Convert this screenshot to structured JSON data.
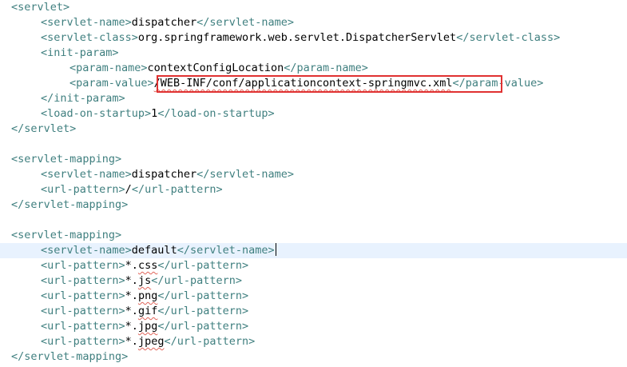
{
  "editor": {
    "lines": [
      {
        "parts": [
          {
            "t": "<servlet>",
            "c": "tag"
          }
        ]
      },
      {
        "parts": [
          {
            "t": "<servlet-name>",
            "c": "tag"
          },
          {
            "t": "dispatcher",
            "c": "text"
          },
          {
            "t": "</servlet-name>",
            "c": "tag"
          }
        ]
      },
      {
        "parts": [
          {
            "t": "<servlet-class>",
            "c": "tag"
          },
          {
            "t": "org.springframework.web.servlet.DispatcherServlet",
            "c": "text"
          },
          {
            "t": "</servlet-class>",
            "c": "tag"
          }
        ]
      },
      {
        "parts": [
          {
            "t": "<init-param>",
            "c": "tag"
          }
        ]
      },
      {
        "parts": [
          {
            "t": "<param-name>",
            "c": "tag"
          },
          {
            "t": "contextConfigLocation",
            "c": "text"
          },
          {
            "t": "</param-name>",
            "c": "tag"
          }
        ]
      },
      {
        "parts": [
          {
            "t": "<param-value>",
            "c": "tag"
          },
          {
            "t": "/WEB-INF/conf/applicationcontext-springmvc.xml",
            "c": "text squiggle"
          },
          {
            "t": "</param-value>",
            "c": "tag"
          }
        ]
      },
      {
        "parts": [
          {
            "t": "</init-param>",
            "c": "tag"
          }
        ]
      },
      {
        "parts": [
          {
            "t": "<load-on-startup>",
            "c": "tag"
          },
          {
            "t": "1",
            "c": "text"
          },
          {
            "t": "</load-on-startup>",
            "c": "tag"
          }
        ]
      },
      {
        "parts": [
          {
            "t": "</servlet>",
            "c": "tag"
          }
        ]
      },
      {
        "parts": []
      },
      {
        "parts": [
          {
            "t": "<servlet-mapping>",
            "c": "tag"
          }
        ]
      },
      {
        "parts": [
          {
            "t": "<servlet-name>",
            "c": "tag"
          },
          {
            "t": "dispatcher",
            "c": "text"
          },
          {
            "t": "</servlet-name>",
            "c": "tag"
          }
        ]
      },
      {
        "parts": [
          {
            "t": "<url-pattern>",
            "c": "tag"
          },
          {
            "t": "/",
            "c": "text"
          },
          {
            "t": "</url-pattern>",
            "c": "tag"
          }
        ]
      },
      {
        "parts": [
          {
            "t": "</servlet-mapping>",
            "c": "tag"
          }
        ]
      },
      {
        "parts": []
      },
      {
        "parts": [
          {
            "t": "<servlet-mapping>",
            "c": "tag"
          }
        ]
      },
      {
        "parts": [
          {
            "t": "<servlet-name>",
            "c": "tag"
          },
          {
            "t": "default",
            "c": "text"
          },
          {
            "t": "</servlet-name>",
            "c": "tag"
          }
        ],
        "current": true
      },
      {
        "parts": [
          {
            "t": "<url-pattern>",
            "c": "tag"
          },
          {
            "t": "*.",
            "c": "text"
          },
          {
            "t": "css",
            "c": "text squiggle"
          },
          {
            "t": "</url-pattern>",
            "c": "tag"
          }
        ]
      },
      {
        "parts": [
          {
            "t": "<url-pattern>",
            "c": "tag"
          },
          {
            "t": "*.",
            "c": "text"
          },
          {
            "t": "js",
            "c": "text squiggle"
          },
          {
            "t": "</url-pattern>",
            "c": "tag"
          }
        ]
      },
      {
        "parts": [
          {
            "t": "<url-pattern>",
            "c": "tag"
          },
          {
            "t": "*.",
            "c": "text"
          },
          {
            "t": "png",
            "c": "text squiggle"
          },
          {
            "t": "</url-pattern>",
            "c": "tag"
          }
        ]
      },
      {
        "parts": [
          {
            "t": "<url-pattern>",
            "c": "tag"
          },
          {
            "t": "*.",
            "c": "text"
          },
          {
            "t": "gif",
            "c": "text squiggle"
          },
          {
            "t": "</url-pattern>",
            "c": "tag"
          }
        ]
      },
      {
        "parts": [
          {
            "t": "<url-pattern>",
            "c": "tag"
          },
          {
            "t": "*.",
            "c": "text"
          },
          {
            "t": "jpg",
            "c": "text squiggle"
          },
          {
            "t": "</url-pattern>",
            "c": "tag"
          }
        ]
      },
      {
        "parts": [
          {
            "t": "<url-pattern>",
            "c": "tag"
          },
          {
            "t": "*.",
            "c": "text"
          },
          {
            "t": "jpeg",
            "c": "text squiggle"
          },
          {
            "t": "</url-pattern>",
            "c": "tag"
          }
        ]
      },
      {
        "parts": [
          {
            "t": "</servlet-mapping>",
            "c": "tag"
          }
        ]
      }
    ]
  },
  "colors": {
    "tag": "#3f7f7f",
    "text": "#000000",
    "current_line": "#e8f2fe",
    "highlight_box": "#e03131",
    "squiggle": "#e0655a"
  }
}
